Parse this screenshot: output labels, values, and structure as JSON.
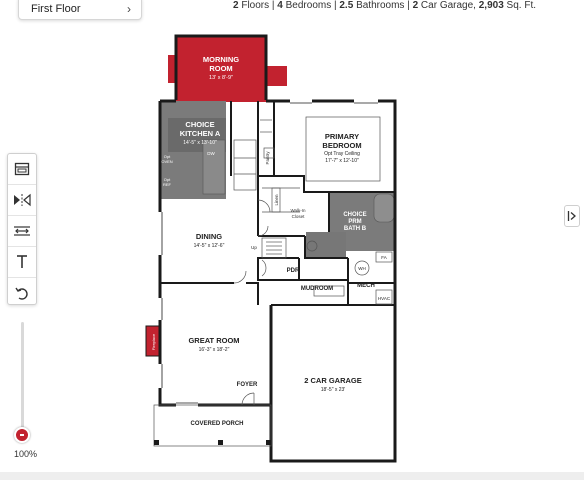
{
  "floor_select": {
    "label": "First Floor"
  },
  "summary": {
    "floors_num": "2",
    "floors_label": "Floors",
    "bedrooms_num": "4",
    "bedrooms_label": "Bedrooms",
    "bathrooms_num": "2.5",
    "bathrooms_label": "Bathrooms",
    "garage_num": "2",
    "garage_label": "Car Garage",
    "sqft_num": "2,903",
    "sqft_label": "Sq. Ft."
  },
  "toolbar": {
    "tools": [
      {
        "icon": "layers-icon"
      },
      {
        "icon": "mirror-icon"
      },
      {
        "icon": "measure-icon"
      },
      {
        "icon": "text-icon"
      },
      {
        "icon": "undo-icon"
      }
    ]
  },
  "zoom": {
    "label": "100%",
    "level_percent": 100
  },
  "colors": {
    "accent_red": "#c2222f",
    "option_gray": "#7a7a7a",
    "wall": "#1a1a1a"
  },
  "rooms": {
    "morning": {
      "name": "MORNING",
      "name2": "ROOM",
      "dims": "13' x 8'-9\""
    },
    "kitchen": {
      "name": "CHOICE",
      "name2": "KITCHEN A",
      "dims": "14'-5\" x 13'-10\""
    },
    "primary": {
      "name": "PRIMARY",
      "name2": "BEDROOM",
      "sub": "Opt Tray Ceiling",
      "dims": "17'-7\" x 12'-10\""
    },
    "bath": {
      "name": "CHOICE",
      "name2": "PRM",
      "name3": "BATH B"
    },
    "dining": {
      "name": "DINING",
      "dims": "14'-5\" x 12'-6\""
    },
    "great": {
      "name": "GREAT ROOM",
      "dims": "16'-3\" x 18'-2\""
    },
    "garage": {
      "name": "2 CAR GARAGE",
      "dims": "18'-5\" x 23'"
    },
    "porch": {
      "name": "COVERED PORCH"
    },
    "foyer": {
      "name": "FOYER"
    },
    "mudroom": {
      "name": "MUDROOM"
    },
    "mech": {
      "name": "MECH"
    },
    "pdr": {
      "name": "PDR"
    },
    "walkin": {
      "name": "Walk-In",
      "name2": "Closet"
    },
    "pantry": {
      "name": "Pantry"
    },
    "linen": {
      "name": "Linen"
    },
    "dw": {
      "name": "DW"
    },
    "oven1": {
      "name": "Opt",
      "name2": "OVEN"
    },
    "oven2": {
      "name": "Opt",
      "name2": "REF"
    },
    "up": {
      "name": "Up"
    },
    "wh": {
      "name": "WH"
    },
    "fa": {
      "name": "FA"
    },
    "hvac": {
      "name": "HVAC"
    },
    "fireplace": {
      "name": "Fireplace"
    }
  }
}
